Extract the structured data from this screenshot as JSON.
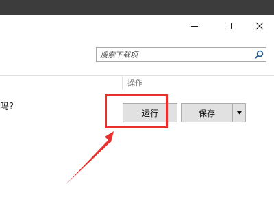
{
  "window": {
    "controls": {
      "minimize_icon": "minimize-icon",
      "maximize_icon": "maximize-icon",
      "close_icon": "close-icon"
    }
  },
  "search": {
    "placeholder": "搜索下载项",
    "value": "",
    "icon": "search-icon"
  },
  "table": {
    "columns": [
      "操作"
    ],
    "rows": [
      {
        "prompt_text": "吗?",
        "actions": {
          "run_label": "运行",
          "save_label": "保存",
          "dropdown_icon": "caret-down-icon"
        }
      }
    ]
  },
  "annotation": {
    "highlight_color": "#e8302f",
    "arrow_color": "#e8302f",
    "highlights": "run-button"
  },
  "colors": {
    "top_strip": "#3c3c3c",
    "button_face": "#e1e1e1",
    "button_border": "#adadad",
    "divider": "#e3e3e3"
  }
}
